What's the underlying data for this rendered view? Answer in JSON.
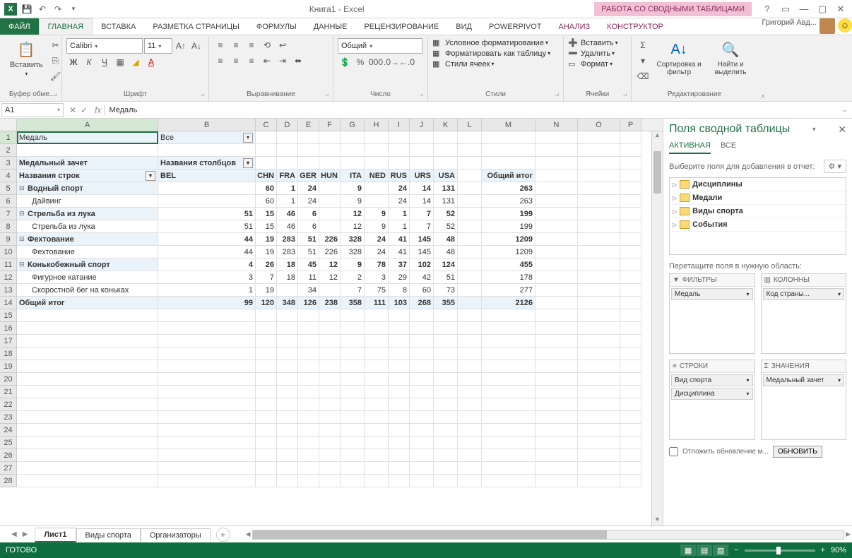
{
  "titlebar": {
    "title": "Книга1 - Excel",
    "context": "РАБОТА СО СВОДНЫМИ ТАБЛИЦАМИ",
    "user": "Григорий Авд..."
  },
  "tabs": [
    "ФАЙЛ",
    "ГЛАВНАЯ",
    "ВСТАВКА",
    "РАЗМЕТКА СТРАНИЦЫ",
    "ФОРМУЛЫ",
    "ДАННЫЕ",
    "РЕЦЕНЗИРОВАНИЕ",
    "ВИД",
    "POWERPIVOT",
    "АНАЛИЗ",
    "КОНСТРУКТОР"
  ],
  "active_tab": 1,
  "ribbon": {
    "clipboard": {
      "paste": "Вставить",
      "group": "Буфер обме..."
    },
    "font": {
      "name": "Calibri",
      "size": "11",
      "group": "Шрифт"
    },
    "align": {
      "group": "Выравнивание"
    },
    "number": {
      "format": "Общий",
      "group": "Число"
    },
    "styles": {
      "cond": "Условное форматирование",
      "table": "Форматировать как таблицу",
      "cell": "Стили ячеек",
      "group": "Стили"
    },
    "cells": {
      "insert": "Вставить",
      "delete": "Удалить",
      "format": "Формат",
      "group": "Ячейки"
    },
    "editing": {
      "sort": "Сортировка и фильтр",
      "find": "Найти и выделить",
      "group": "Редактирование"
    }
  },
  "formula": {
    "cell_ref": "A1",
    "value": "Медаль"
  },
  "columns": [
    "A",
    "B",
    "C",
    "D",
    "E",
    "F",
    "G",
    "H",
    "I",
    "J",
    "K",
    "L",
    "M",
    "N",
    "O",
    "P"
  ],
  "pivot": {
    "filter_label": "Медаль",
    "filter_value": "Все",
    "header_a": "Медальный зачет",
    "header_b": "Названия столбцов",
    "row_header": "Названия строк",
    "col_heads": [
      "BEL",
      "CHN",
      "FRA",
      "GER",
      "HUN",
      "ITA",
      "NED",
      "RUS",
      "URS",
      "USA",
      "Общий итог"
    ],
    "rows": [
      {
        "lvl": 0,
        "label": "Водный спорт",
        "v": [
          "",
          "60",
          "1",
          "24",
          "",
          "9",
          "",
          "24",
          "14",
          "131",
          "263"
        ]
      },
      {
        "lvl": 1,
        "label": "Дайвинг",
        "v": [
          "",
          "60",
          "1",
          "24",
          "",
          "9",
          "",
          "24",
          "14",
          "131",
          "263"
        ]
      },
      {
        "lvl": 0,
        "label": "Стрельба из лука",
        "v": [
          "51",
          "15",
          "46",
          "6",
          "",
          "12",
          "9",
          "1",
          "7",
          "52",
          "199"
        ]
      },
      {
        "lvl": 1,
        "label": "Стрельба из лука",
        "v": [
          "51",
          "15",
          "46",
          "6",
          "",
          "12",
          "9",
          "1",
          "7",
          "52",
          "199"
        ]
      },
      {
        "lvl": 0,
        "label": "Фехтование",
        "v": [
          "44",
          "19",
          "283",
          "51",
          "226",
          "328",
          "24",
          "41",
          "145",
          "48",
          "1209"
        ]
      },
      {
        "lvl": 1,
        "label": "Фехтование",
        "v": [
          "44",
          "19",
          "283",
          "51",
          "226",
          "328",
          "24",
          "41",
          "145",
          "48",
          "1209"
        ]
      },
      {
        "lvl": 0,
        "label": "Конькобежный спорт",
        "v": [
          "4",
          "26",
          "18",
          "45",
          "12",
          "9",
          "78",
          "37",
          "102",
          "124",
          "455"
        ]
      },
      {
        "lvl": 1,
        "label": "Фигурное катание",
        "v": [
          "3",
          "7",
          "18",
          "11",
          "12",
          "2",
          "3",
          "29",
          "42",
          "51",
          "178"
        ]
      },
      {
        "lvl": 1,
        "label": "Скоростной бег на коньках",
        "v": [
          "1",
          "19",
          "",
          "34",
          "",
          "7",
          "75",
          "8",
          "60",
          "73",
          "277"
        ]
      }
    ],
    "total_label": "Общий итог",
    "totals": [
      "99",
      "120",
      "348",
      "126",
      "238",
      "358",
      "111",
      "103",
      "268",
      "355",
      "2126"
    ]
  },
  "pane": {
    "title": "Поля сводной таблицы",
    "tab_active": "АКТИВНАЯ",
    "tab_all": "ВСЕ",
    "hint": "Выберите поля для добавления в отчет:",
    "fields": [
      "Дисциплины",
      "Медали",
      "Виды спорта",
      "События"
    ],
    "drag_hint": "Перетащите поля в нужную область:",
    "areas": {
      "filters": "ФИЛЬТРЫ",
      "columns": "КОЛОННЫ",
      "rows": "СТРОКИ",
      "values": "ЗНАЧЕНИЯ"
    },
    "filter_field": "Медаль",
    "col_field": "Код страны...",
    "row_field1": "Вид спорта",
    "row_field2": "Дисциплина",
    "val_field": "Медальный зачет",
    "defer": "Отложить обновление м...",
    "update": "ОБНОВИТЬ"
  },
  "sheets": [
    "Лист1",
    "Виды спорта",
    "Организаторы"
  ],
  "status": {
    "ready": "ГОТОВО",
    "zoom": "90%"
  }
}
